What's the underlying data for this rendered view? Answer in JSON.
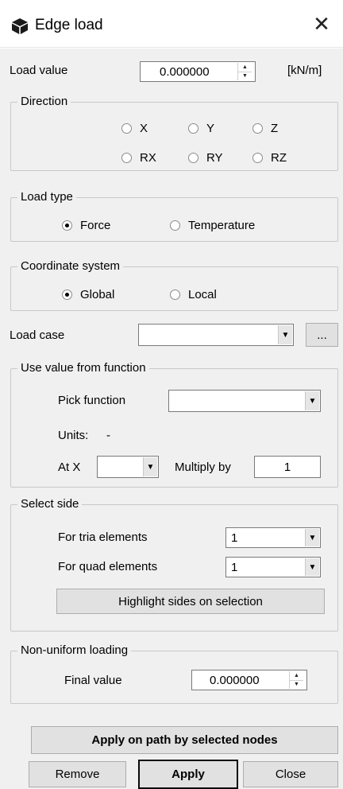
{
  "window": {
    "title": "Edge load",
    "title_icon": "cube-icon",
    "close_glyph": "✕"
  },
  "load_value": {
    "label": "Load value",
    "value": "0.000000",
    "unit": "[kN/m]"
  },
  "direction": {
    "legend": "Direction",
    "options": [
      "X",
      "Y",
      "Z",
      "RX",
      "RY",
      "RZ"
    ],
    "selected": null
  },
  "load_type": {
    "legend": "Load type",
    "options": [
      "Force",
      "Temperature"
    ],
    "selected": "Force"
  },
  "coordinate_system": {
    "legend": "Coordinate system",
    "options": [
      "Global",
      "Local"
    ],
    "selected": "Global"
  },
  "load_case": {
    "label": "Load case",
    "value": "",
    "browse_label": "..."
  },
  "function_group": {
    "legend": "Use value from function",
    "pick_label": "Pick function",
    "pick_value": "",
    "units_label": "Units:",
    "units_value": "-",
    "at_x_label": "At X",
    "at_x_value": "",
    "multiply_label": "Multiply by",
    "multiply_value": "1"
  },
  "select_side": {
    "legend": "Select side",
    "tria_label": "For tria elements",
    "tria_value": "1",
    "quad_label": "For quad elements",
    "quad_value": "1",
    "highlight_label": "Highlight sides on selection"
  },
  "non_uniform": {
    "legend": "Non-uniform loading",
    "final_label": "Final value",
    "final_value": "0.000000"
  },
  "buttons": {
    "apply_path": "Apply on path by selected nodes",
    "remove": "Remove",
    "apply": "Apply",
    "close": "Close"
  },
  "colors": {
    "dialog_bg": "#f0f0f0",
    "button_bg": "#e1e1e1",
    "field_border": "#7a7a7a"
  }
}
